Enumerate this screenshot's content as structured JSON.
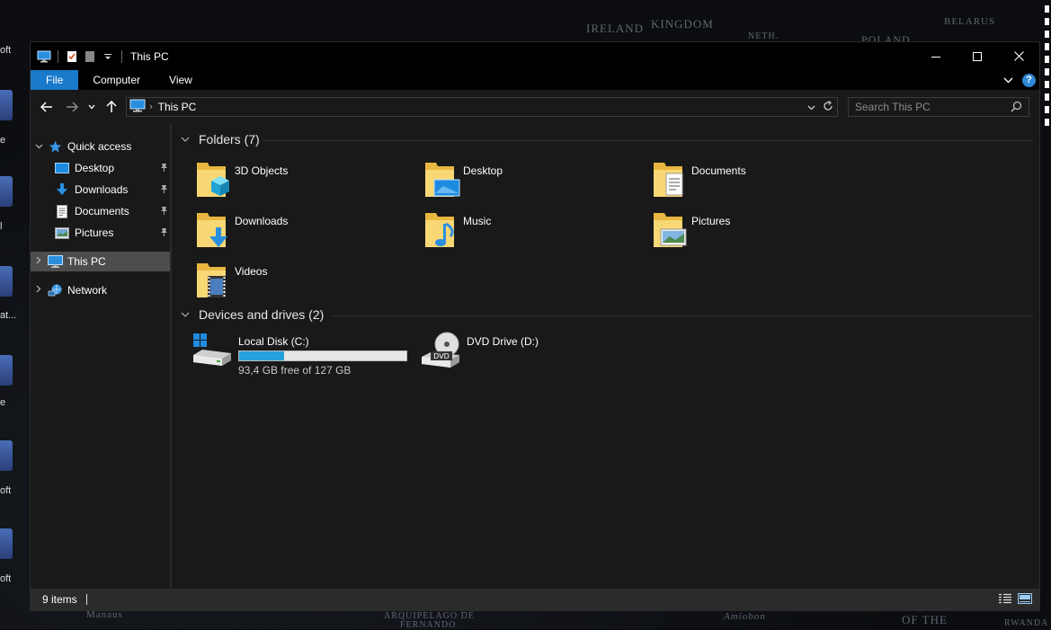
{
  "window": {
    "title": "This PC"
  },
  "ribbon": {
    "tabs": [
      "File",
      "Computer",
      "View"
    ],
    "help_label": "?"
  },
  "address": {
    "path": "This PC",
    "search_placeholder": "Search This PC"
  },
  "sidebar": {
    "quick_access": "Quick access",
    "items": [
      {
        "label": "Desktop",
        "icon": "desktop-icon"
      },
      {
        "label": "Downloads",
        "icon": "downloads-icon"
      },
      {
        "label": "Documents",
        "icon": "documents-icon"
      },
      {
        "label": "Pictures",
        "icon": "pictures-icon"
      }
    ],
    "this_pc": "This PC",
    "network": "Network"
  },
  "folders": {
    "heading": "Folders (7)",
    "items": [
      {
        "label": "3D Objects",
        "icon": "3d-objects-icon"
      },
      {
        "label": "Desktop",
        "icon": "desktop-folder-icon"
      },
      {
        "label": "Documents",
        "icon": "documents-folder-icon"
      },
      {
        "label": "Downloads",
        "icon": "downloads-folder-icon"
      },
      {
        "label": "Music",
        "icon": "music-folder-icon"
      },
      {
        "label": "Pictures",
        "icon": "pictures-folder-icon"
      },
      {
        "label": "Videos",
        "icon": "videos-folder-icon"
      }
    ]
  },
  "drives": {
    "heading": "Devices and drives (2)",
    "local": {
      "label": "Local Disk (C:)",
      "free": "93,4 GB free of 127 GB",
      "used_fraction": 0.27
    },
    "dvd": {
      "label": "DVD Drive (D:)",
      "badge": "DVD"
    }
  },
  "status": {
    "count": "9 items"
  },
  "desktop": {
    "map_labels": [
      "IRELAND",
      "KINGDOM",
      "POLAND",
      "BELARUS",
      "NETH.",
      "ARQUIPÉLAGO DE",
      "FERNANDO",
      "Amiobon",
      "OF THE",
      "RWANDA",
      "Manaus"
    ],
    "icon_labels": [
      "oft",
      "e",
      "l",
      "at...",
      "e",
      "oft",
      "oft"
    ]
  },
  "colors": {
    "accent": "#1979ca",
    "selection": "#4d4d4d",
    "drive_bar": "#26a0da",
    "folder": "#f8d775"
  }
}
